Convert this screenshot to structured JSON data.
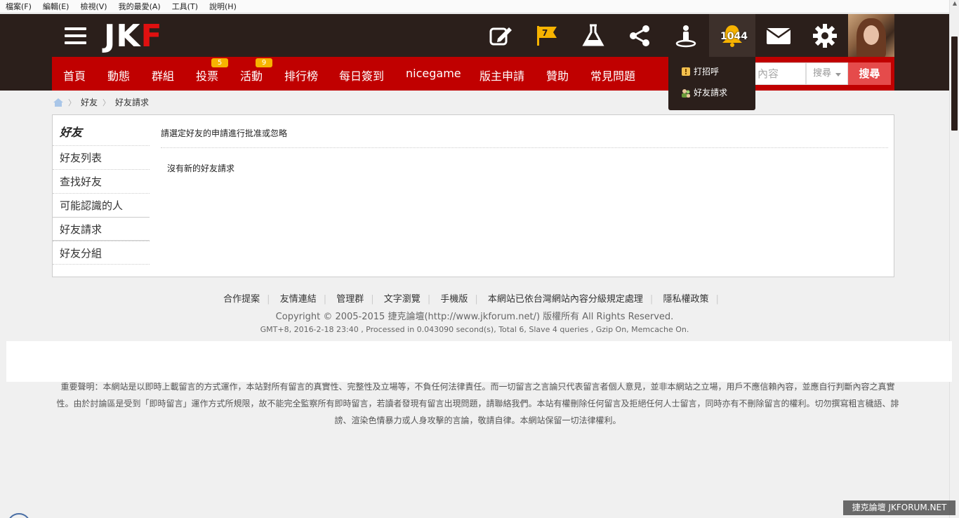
{
  "menubar": [
    "檔案(F)",
    "編輯(E)",
    "檢視(V)",
    "我的最愛(A)",
    "工具(T)",
    "說明(H)"
  ],
  "header": {
    "logo_white": "JK",
    "logo_red": "F",
    "flag_count": "7",
    "notification_count": "1044"
  },
  "nav": {
    "items": [
      {
        "label": "首頁"
      },
      {
        "label": "動態"
      },
      {
        "label": "群組"
      },
      {
        "label": "投票",
        "badge": "5"
      },
      {
        "label": "活動",
        "badge": "9"
      },
      {
        "label": "排行榜"
      },
      {
        "label": "每日簽到"
      },
      {
        "label": "nicegame"
      },
      {
        "label": "版主申請"
      },
      {
        "label": "贊助"
      },
      {
        "label": "常見問題"
      }
    ],
    "search_placeholder": "內容",
    "search_select": "搜尋",
    "search_button": "搜尋"
  },
  "dropdown": {
    "items": [
      "打招呼",
      "好友請求"
    ]
  },
  "breadcrumb": [
    "好友",
    "好友請求"
  ],
  "sidebar": {
    "title": "好友",
    "items": [
      "好友列表",
      "查找好友",
      "可能認識的人",
      "好友請求",
      "好友分組"
    ]
  },
  "content": {
    "heading": "請選定好友的申請進行批准或忽略",
    "empty": "沒有新的好友請求"
  },
  "footer": {
    "links": [
      "合作提案",
      "友情連結",
      "管理群",
      "文字瀏覽",
      "手機版",
      "本網站已依台灣網站內容分級規定處理",
      "隱私權政策"
    ],
    "copyright": "Copyright © 2005-2015 捷克論壇(http://www.jkforum.net/) 版權所有 All Rights Reserved.",
    "stats": "GMT+8, 2016-2-18 23:40 , Processed in 0.043090 second(s), Total 6, Slave 4 queries , Gzip On, Memcache On.",
    "disclaimer": "重要聲明：本網站是以即時上載留言的方式運作，本站對所有留言的真實性、完整性及立場等，不負任何法律責任。而一切留言之言論只代表留言者個人意見，並非本網站之立場，用戶不應信賴內容，並應自行判斷內容之真實性。由於討論區是受到「即時留言」運作方式所規限，故不能完全監察所有即時留言，若讀者發現有留言出現問題，請聯絡我們。本站有權刪除任何留言及拒絕任何人士留言，同時亦有不刪除留言的權利。切勿撰寫粗言穢語、誹謗、渲染色情暴力或人身攻擊的言論，敬請自律。本網站保留一切法律權利。"
  },
  "watermark": "捷克論壇 JKFORUM.NET",
  "colors": {
    "header_bg": "#2b1f1b",
    "nav_red": "#c00000",
    "search_btn": "#e54b4b",
    "badge": "#f7b300",
    "bell": "#f7b300"
  }
}
